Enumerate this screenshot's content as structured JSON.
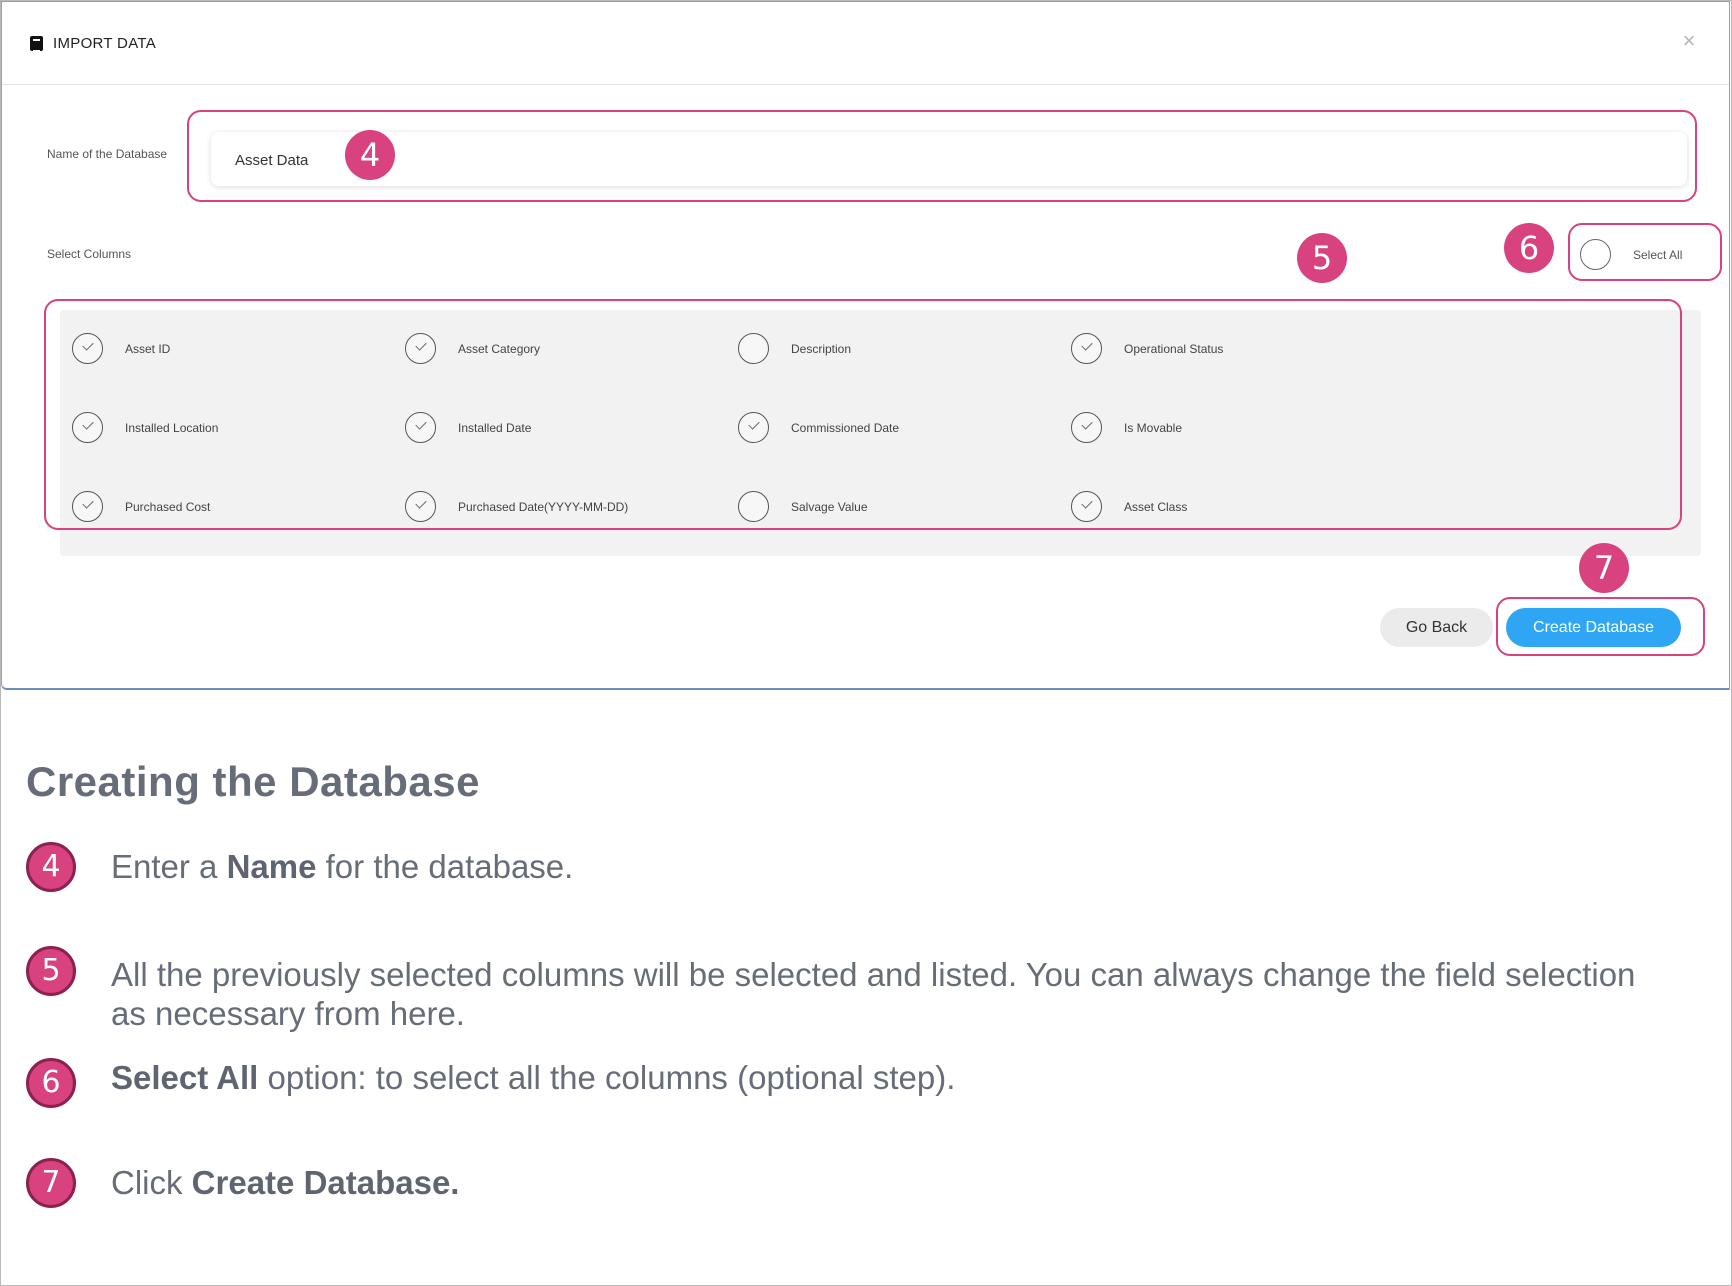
{
  "dialog": {
    "title": "IMPORT DATA",
    "close_label": "×",
    "db_name_label": "Name of the Database",
    "db_name_value": "Asset Data",
    "select_columns_label": "Select Columns",
    "select_all_label": "Select All",
    "select_all_checked": false,
    "columns": [
      {
        "label": "Asset ID",
        "checked": true
      },
      {
        "label": "Asset Category",
        "checked": true
      },
      {
        "label": "Description",
        "checked": false
      },
      {
        "label": "Operational Status",
        "checked": true
      },
      {
        "label": "Installed Location",
        "checked": true
      },
      {
        "label": "Installed Date",
        "checked": true
      },
      {
        "label": "Commissioned Date",
        "checked": true
      },
      {
        "label": "Is Movable",
        "checked": true
      },
      {
        "label": "Purchased Cost",
        "checked": true
      },
      {
        "label": "Purchased Date(YYYY-MM-DD)",
        "checked": true
      },
      {
        "label": "Salvage Value",
        "checked": false
      },
      {
        "label": "Asset Class",
        "checked": true
      }
    ],
    "go_back_label": "Go Back",
    "create_label": "Create Database"
  },
  "callouts": [
    "4",
    "5",
    "6",
    "7"
  ],
  "doc": {
    "title": "Creating the Database",
    "steps": [
      {
        "num": "4",
        "pre": "Enter a ",
        "bold": "Name",
        "post": " for the database."
      },
      {
        "num": "5",
        "pre": "All the previously selected columns will be selected and listed. You can always change the field selection as necessary from here.",
        "bold": "",
        "post": ""
      },
      {
        "num": "6",
        "pre": "",
        "bold": "Select All",
        "post": " option: to select all the columns (optional step)."
      },
      {
        "num": "7",
        "pre": "Click ",
        "bold": "Create Database.",
        "post": ""
      }
    ]
  },
  "colors": {
    "accent": "#d8427f",
    "primary_button": "#2ea6f3",
    "doc_text": "#676d78"
  }
}
